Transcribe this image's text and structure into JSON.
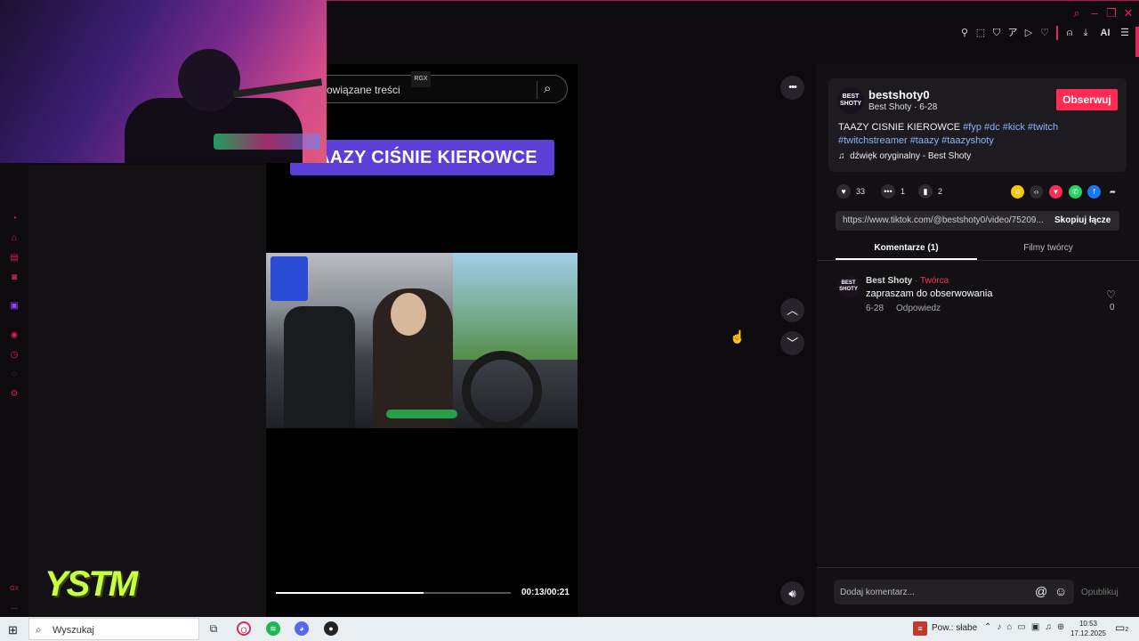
{
  "browser": {
    "toolbar_icons": [
      "pin-icon",
      "snapshot-icon",
      "shield-icon",
      "translate-icon",
      "play-icon",
      "heart-icon",
      "profile-icon",
      "download-icon",
      "ai-icon",
      "menu-icon"
    ],
    "ai_label": "AI",
    "sidebar_icons": [
      "gx-corner-icon",
      "ai-bot-icon",
      "messenger-icon",
      "instagram-icon",
      "twitch-icon",
      "player-icon",
      "history-icon",
      "whatsapp-icon",
      "settings-icon"
    ],
    "gx_label": "GX",
    "more_label": "..."
  },
  "overlay": {
    "ystm_logo": "YSTM"
  },
  "video": {
    "search_text": "owiązane treści",
    "rgx_label": "RGX",
    "banner_text": "TAAZY CIŚNIE KIEROWCE",
    "time": "00:13/00:21",
    "progress": 0.63,
    "more_label": "•••"
  },
  "post": {
    "username": "bestshoty0",
    "subline": "Best Shoty · 6-28",
    "avatar_text": "BEST SHOTY",
    "follow_label": "Obserwuj",
    "desc_plain": "TAAZY CISNIE KIEROWCE ",
    "desc_tags1": "#fyp #dc #kick #twitch",
    "desc_tags2": "#twitchstreamer #taazy #taazyshoty",
    "sound": "dźwięk oryginalny - Best Shoty",
    "likes": "33",
    "comments": "1",
    "saves": "2",
    "link": "https://www.tiktok.com/@bestshoty0/video/75209...",
    "copy_label": "Skopiuj łącze",
    "tab_comments": "Komentarze (1)",
    "tab_videos": "Filmy twórcy"
  },
  "comment": {
    "avatar_text": "BEST SHOTY",
    "author": "Best Shoty",
    "creator_label": " · Twórca",
    "text": "zapraszam do obserwowania",
    "date": "6-28",
    "reply": "Odpowiedz",
    "likes": "0"
  },
  "composer": {
    "placeholder": "Dodaj komentarz...",
    "publish": "Opublikuj"
  },
  "taskbar": {
    "search": "Wyszukaj",
    "weather": "Pow.: słabe",
    "time": "10:53",
    "date": "17.12.2025",
    "notif_count": "2"
  },
  "colors": {
    "accent": "#fe2c55",
    "opera": "#e0245e",
    "banner": "#5b3fd6",
    "tag": "#8ab4ff"
  }
}
